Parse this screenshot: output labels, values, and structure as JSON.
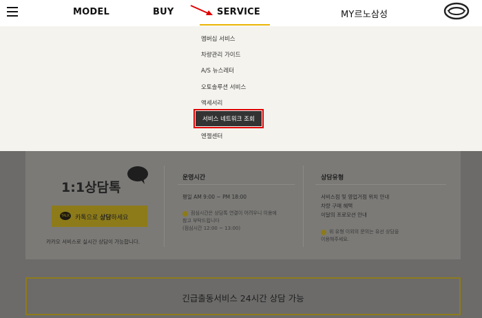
{
  "nav": {
    "items": [
      "MODEL",
      "BUY",
      "SERVICE",
      "MY르노삼성"
    ]
  },
  "submenu": {
    "items": [
      "멤버십 서비스",
      "차량관리 가이드",
      "A/S 뉴스레터",
      "오토솔루션 서비스",
      "액세서리",
      "서비스 네트워크 조회",
      "엔젤센터"
    ],
    "active": "서비스 네트워크 조회"
  },
  "consult": {
    "title": "1:1상담톡",
    "kakao_button_prefix": "카톡으로 ",
    "kakao_button_bold": "상담",
    "kakao_button_suffix": "하세요",
    "kakao_icon_text": "TALK",
    "kakao_note": "카카오 서비스로 실시간 상담이 가능합니다."
  },
  "hours": {
    "title": "운영시간",
    "time": "평일 AM 9:00 ~ PM 18:00",
    "note_lines": [
      "점심시간은 상담톡 연결이 어려우니 이용에",
      "참고 부탁드립니다",
      "(점심시간 12:00 ~ 13:00)"
    ]
  },
  "types": {
    "title": "상담유형",
    "lines": [
      "서비스점 및 영업거점 위치 안내",
      "차량 구매 혜택",
      "이달의 프로모션 안내"
    ],
    "note_lines": [
      "위 유형 이외의 문의는 유선 상담을",
      "이용해주세요."
    ]
  },
  "emergency": {
    "label": "긴급출동서비스 24시간 상담 가능"
  },
  "colors": {
    "accent": "#e8b400",
    "highlight_border": "#e10000"
  }
}
